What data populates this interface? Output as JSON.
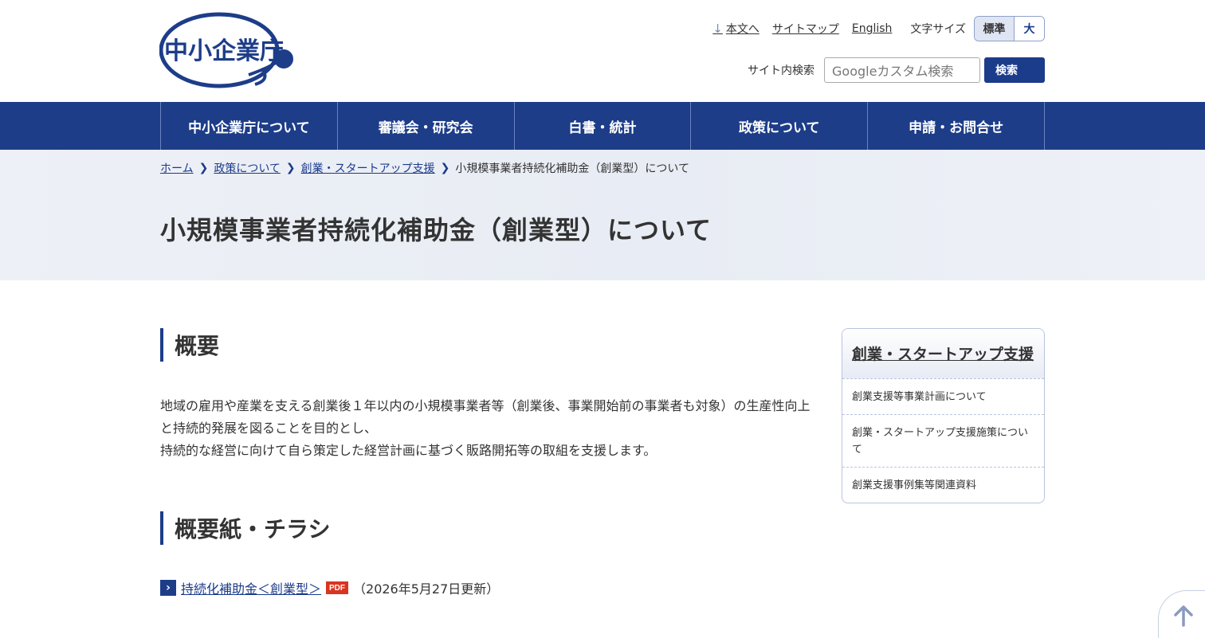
{
  "header": {
    "logo_text": "中小企業庁",
    "skip_link": "本文へ",
    "sitemap": "サイトマップ",
    "english": "English",
    "font_size_label": "文字サイズ",
    "font_standard": "標準",
    "font_large": "大",
    "search_label": "サイト内検索",
    "search_placeholder": "Googleカスタム検索",
    "search_button": "検索"
  },
  "nav": [
    "中小企業庁について",
    "審議会・研究会",
    "白書・統計",
    "政策について",
    "申請・お問合せ"
  ],
  "breadcrumb": {
    "home": "ホーム",
    "policy": "政策について",
    "startup": "創業・スタートアップ支援",
    "current": "小規模事業者持続化補助金（創業型）について"
  },
  "page_title": "小規模事業者持続化補助金（創業型）について",
  "main": {
    "section1_heading": "概要",
    "section1_line1": "地域の雇用や産業を支える創業後１年以内の小規模事業者等（創業後、事業開始前の事業者も対象）の生産性向上と持続的発展を図ることを目的とし、",
    "section1_line2": "持続的な経営に向けて自ら策定した経営計画に基づく販路開拓等の取組を支援します。",
    "section2_heading": "概要紙・チラシ",
    "doc_link": "持続化補助金＜創業型＞",
    "doc_badge": "PDF",
    "doc_updated": "（2026年5月27日更新）"
  },
  "side": {
    "title": "創業・スタートアップ支援",
    "items": [
      "創業支援等事業計画について",
      "創業・スタートアップ支援施策について",
      "創業支援事例集等関連資料"
    ]
  },
  "icons": {
    "skip": "arrow-down-icon",
    "crumb_sep": "chevron-right-icon",
    "doc": "chevron-right-icon",
    "pagetop": "arrow-up-icon"
  },
  "colors": {
    "brand": "#1d3d89",
    "pdf": "#d9341f"
  }
}
